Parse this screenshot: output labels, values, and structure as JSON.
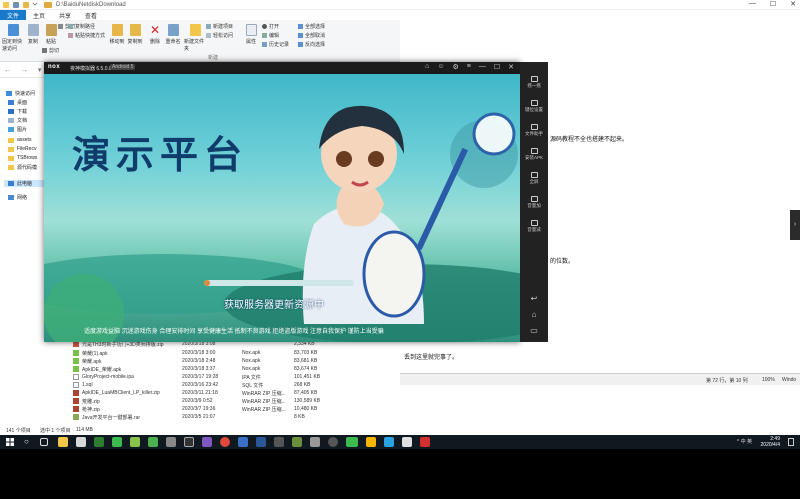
{
  "explorer": {
    "path": "D:\\BaiduNetdiskDownload",
    "tabs": [
      "文件",
      "主页",
      "共享",
      "查看"
    ],
    "ribbon": {
      "pin_label": "固定到快速访问",
      "copy_label": "复制",
      "paste_label": "粘贴",
      "cut_label": "剪切",
      "copy_path_label": "复制路径",
      "paste_shortcut_label": "粘贴快捷方式",
      "move_to_label": "移动到",
      "copy_to_label": "复制到",
      "delete_label": "删除",
      "rename_label": "重命名",
      "new_folder_label": "新建文件夹",
      "new_item_label": "新建项目",
      "easy_access_label": "轻松访问",
      "properties_label": "属性",
      "open_label": "打开",
      "edit_label": "编辑",
      "history_label": "历史记录",
      "select_all_label": "全部选择",
      "select_none_label": "全部取消",
      "invert_selection_label": "反向选择",
      "group_new": "新建"
    },
    "nav": [
      {
        "label": "快速访问"
      },
      {
        "label": "桌面"
      },
      {
        "label": "下载"
      },
      {
        "label": "文档"
      },
      {
        "label": "图片"
      },
      {
        "label": "assets"
      },
      {
        "label": "FileRecv"
      },
      {
        "label": "TSBrows"
      },
      {
        "label": "源代码模"
      },
      {
        "label": "此电脑"
      },
      {
        "label": "网络"
      }
    ],
    "files": [
      {
        "name": "元是TH3时新子功门+3D类师排版.zip",
        "date": "2020/3/18 3:08",
        "type": "",
        "size": "2,334 KB"
      },
      {
        "name": "荣耀(1).apk",
        "date": "2020/3/18 3:00",
        "type": "Nox.apk",
        "size": "83,703 KB"
      },
      {
        "name": "荣耀.apk",
        "date": "2020/3/18 2:48",
        "type": "Nox.apk",
        "size": "83,681 KB"
      },
      {
        "name": "ApkIDE_荣耀.apk",
        "date": "2020/3/18 3:37",
        "type": "Nox.apk",
        "size": "83,674 KB"
      },
      {
        "name": "GloryProject-mobile.ipa",
        "date": "2020/3/17 19:28",
        "type": "IPA 文件",
        "size": "101,451 KB"
      },
      {
        "name": "1.sql",
        "date": "2020/3/16 23:42",
        "type": "SQL 文件",
        "size": "268 KB"
      },
      {
        "name": "ApkIDE_LuaMBClient_LP_killer.zip",
        "date": "2020/3/11 21:18",
        "type": "WinRAR ZIP 压缩...",
        "size": "87,405 KB"
      },
      {
        "name": "荒雕.zip",
        "date": "2020/3/9 0:52",
        "type": "WinRAR ZIP 压缩...",
        "size": "130,589 KB"
      },
      {
        "name": "枪神.zip",
        "date": "2020/3/7 19:36",
        "type": "WinRAR ZIP 压缩...",
        "size": "10,480 KB"
      },
      {
        "name": "Java开发平台一键部署.rar",
        "date": "2020/3/5 21:07",
        "type": "",
        "size": "8 KB"
      }
    ],
    "status": {
      "count": "141 个项目",
      "selected": "选中 1 个项目",
      "size": "114 MB"
    }
  },
  "emulator": {
    "logo": "nox",
    "name": "夜神模拟器 6.5.0.0",
    "android": "Android 5",
    "game_title": "演示平台",
    "loading_text": "获取服务器更新资源中",
    "notice": "适度游戏益脑 沉迷游戏伤身 合理安排时间 享受健康生活 抵制不良游戏 拒绝盗版游戏 注意自我保护 谨防上当受骗",
    "sidebar": [
      "摇一摇",
      "键位设置",
      "文件助手",
      "安装APK",
      "全屏",
      "音量加",
      "音量减"
    ]
  },
  "document": {
    "line1": "源码教程不全也搭建不起来。",
    "line2": "的位数。",
    "line3": "丢到这里就完事了。",
    "status_pos": "第 72 行，第 10 列",
    "status_zoom": "100%",
    "status_enc": "Windo"
  },
  "taskbar": {
    "time": "2:49",
    "date": "2020/4/4",
    "ime": "英",
    "tray_text": "^ 中 英"
  },
  "colors": {
    "accent": "#1979ca",
    "taskbar": "#101820",
    "emulator_frame": "#1b1b1b"
  }
}
